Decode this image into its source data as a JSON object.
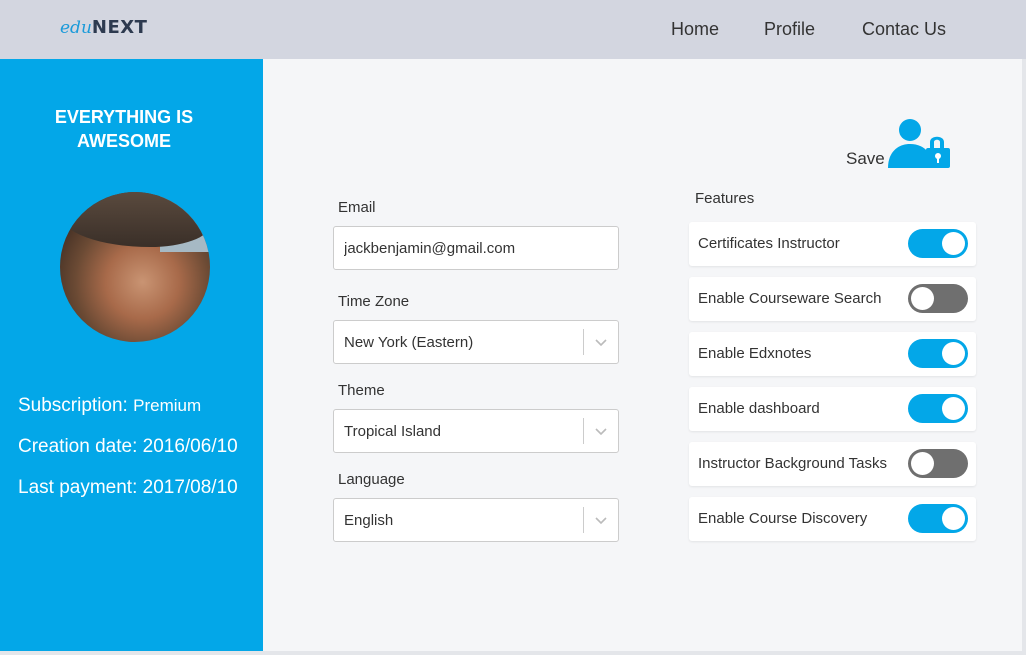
{
  "header": {
    "logo_prefix": "edu",
    "logo_suffix": "NEXT",
    "nav": [
      {
        "label": "Home"
      },
      {
        "label": "Profile"
      },
      {
        "label": "Contac Us"
      }
    ]
  },
  "sidebar": {
    "title_line1": "EVERYTHING IS",
    "title_line2": "AWESOME",
    "subscription_label": "Subscription:",
    "subscription_value": "Premium",
    "creation_label": "Creation date:",
    "creation_value": "2016/06/10",
    "payment_label": "Last payment:",
    "payment_value": "2017/08/10"
  },
  "save": {
    "label": "Save",
    "icon": "user-lock-icon"
  },
  "form": {
    "email_label": "Email",
    "email_value": "jackbenjamin@gmail.com",
    "timezone_label": "Time Zone",
    "timezone_value": "New York (Eastern)",
    "theme_label": "Theme",
    "theme_value": "Tropical Island",
    "language_label": "Language",
    "language_value": "English"
  },
  "features": {
    "label": "Features",
    "items": [
      {
        "label": "Certificates Instructor",
        "enabled": true
      },
      {
        "label": "Enable Courseware Search",
        "enabled": false
      },
      {
        "label": "Enable Edxnotes",
        "enabled": true
      },
      {
        "label": "Enable dashboard",
        "enabled": true
      },
      {
        "label": "Instructor Background Tasks",
        "enabled": false
      },
      {
        "label": "Enable Course Discovery",
        "enabled": true
      }
    ]
  },
  "colors": {
    "accent": "#03a7e8",
    "toggle_off": "#6f6f6f",
    "topbar": "#d3d6e0"
  }
}
